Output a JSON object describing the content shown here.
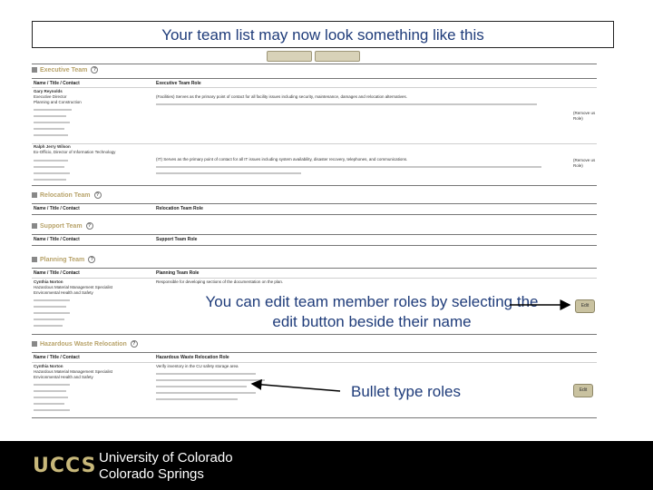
{
  "slide": {
    "title": "Your team list may now look something like this",
    "notes": {
      "edit_roles": "You can edit team member roles by selecting the edit button beside their name",
      "bullet_roles": "Bullet type roles"
    }
  },
  "screenshot": {
    "sections": [
      {
        "heading": "Executive Team",
        "col1": "Name / Title / Contact",
        "col2": "Executive Team Role"
      },
      {
        "heading": "Relocation Team",
        "col1": "Name / Title / Contact",
        "col2": "Relocation Team Role"
      },
      {
        "heading": "Support Team",
        "col1": "Name / Title / Contact",
        "col2": "Support Team Role"
      },
      {
        "heading": "Planning Team",
        "col1": "Name / Title / Contact",
        "col2": "Planning Team Role"
      },
      {
        "heading": "Hazardous Waste Relocation",
        "col1": "Name / Title / Contact",
        "col2": "Hazardous Waste Relocation Role"
      }
    ],
    "members": [
      {
        "name": "Gary Reynolds",
        "lines": [
          "Executive Director",
          "Planning and Construction"
        ]
      },
      {
        "name": "Ralph Jerry Wilson",
        "lines": [
          "Ex-Officio, Director of Information Technology"
        ]
      },
      {
        "name": "Cynthia Norton",
        "lines": [
          "Hazardous Material Management Specialist",
          "Environmental Health and Safety"
        ]
      },
      {
        "name": "Cynthia Norton",
        "lines": [
          "Hazardous Material Management Specialist",
          "Environmental Health and Safety"
        ]
      }
    ],
    "roles": {
      "exec_1": "(Facilities) Serves as the primary point of contact for all facility issues including security, maintenance, damages and relocation alternatives.",
      "exec_2": "(IT) Serves as the primary point of contact for all IT issues including system availability, disaster recovery, telephones, and communications.",
      "planning": "Responsible for developing sections of the documentation on the plan.",
      "haz": "Verify inventory in the CU safety storage area"
    },
    "remove_label": "(Remove us Role)",
    "edit_label": "Edit"
  },
  "footer": {
    "logo": "UCCS",
    "university_line1": "University of Colorado",
    "university_line2": "Colorado Springs"
  }
}
